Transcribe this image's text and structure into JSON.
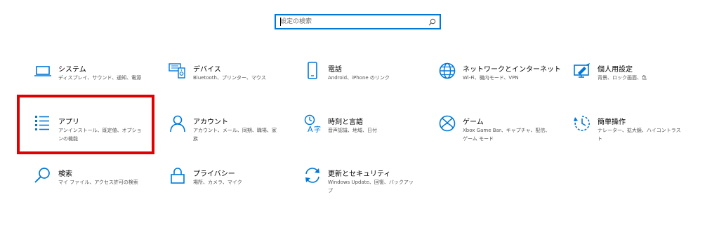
{
  "search": {
    "placeholder": "設定の検索"
  },
  "accent_color": "#0078d7",
  "highlight_color": "#e00000",
  "tiles": [
    {
      "title": "システム",
      "desc": "ディスプレイ、サウンド、通知、電源",
      "icon": "laptop-icon"
    },
    {
      "title": "デバイス",
      "desc": "Bluetooth、プリンター、マウス",
      "icon": "devices-icon"
    },
    {
      "title": "電話",
      "desc": "Android、iPhone のリンク",
      "icon": "phone-icon"
    },
    {
      "title": "ネットワークとインターネット",
      "desc": "Wi-Fi、機内モード、VPN",
      "icon": "globe-icon"
    },
    {
      "title": "個人用設定",
      "desc": "背景、ロック画面、色",
      "icon": "personalization-icon"
    },
    {
      "title": "アプリ",
      "desc": "アンインストール、既定値、オプションの機能",
      "icon": "apps-list-icon"
    },
    {
      "title": "アカウント",
      "desc": "アカウント、メール、同期、職場、家族",
      "icon": "person-icon"
    },
    {
      "title": "時刻と言語",
      "desc": "音声認識、地域、日付",
      "icon": "time-language-icon"
    },
    {
      "title": "ゲーム",
      "desc": "Xbox Game Bar、キャプチャ、配信、ゲーム モード",
      "icon": "xbox-icon"
    },
    {
      "title": "簡単操作",
      "desc": "ナレーター、拡大鏡、ハイコントラスト",
      "icon": "ease-of-access-icon"
    },
    {
      "title": "検索",
      "desc": "マイ ファイル、アクセス許可の検索",
      "icon": "search-icon"
    },
    {
      "title": "プライバシー",
      "desc": "場所、カメラ、マイク",
      "icon": "lock-icon"
    },
    {
      "title": "更新とセキュリティ",
      "desc": "Windows Update、回復、バックアップ",
      "icon": "sync-icon"
    }
  ]
}
